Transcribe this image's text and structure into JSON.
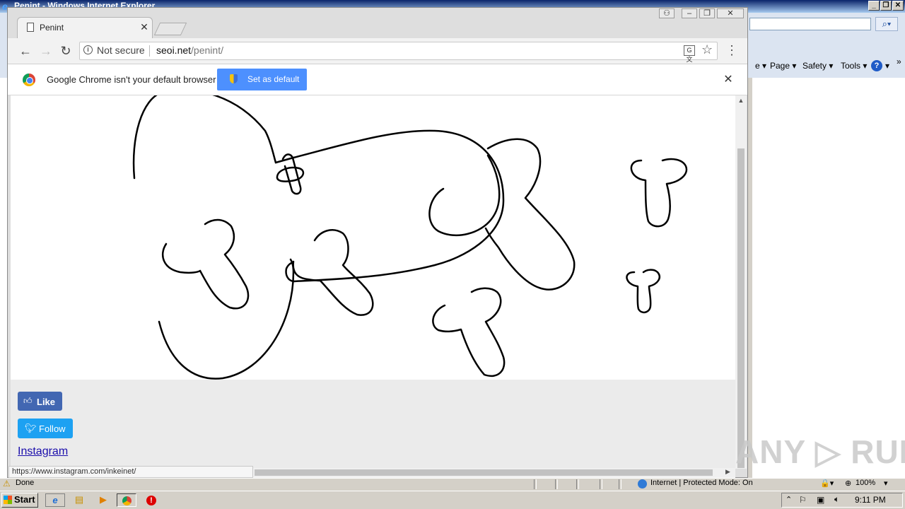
{
  "ie": {
    "title": "Penint - Windows Internet Explorer",
    "menu": {
      "page": "Page ▾",
      "safety": "Safety ▾",
      "tools": "Tools ▾",
      "help": "?"
    },
    "status": {
      "done": "Done",
      "zone": "Internet | Protected Mode: On",
      "zoom": "100%"
    }
  },
  "chrome": {
    "tab_title": "Penint",
    "security_label": "Not secure",
    "url_host": "seoi.net",
    "url_path": "/penint/",
    "infobar": {
      "message": "Google Chrome isn't your default browser",
      "button": "Set as default"
    },
    "status_url": "https://www.instagram.com/inkeinet/"
  },
  "page": {
    "like": "Like",
    "follow": "Follow",
    "instagram": "Instagram"
  },
  "watermark": "ANY ▷ RUN",
  "taskbar": {
    "start": "Start",
    "clock": "9:11 PM"
  },
  "colors": {
    "facebook": "#4267b2",
    "twitter": "#1da1f2",
    "chrome_button": "#4d90fe",
    "link": "#1a0dab"
  }
}
